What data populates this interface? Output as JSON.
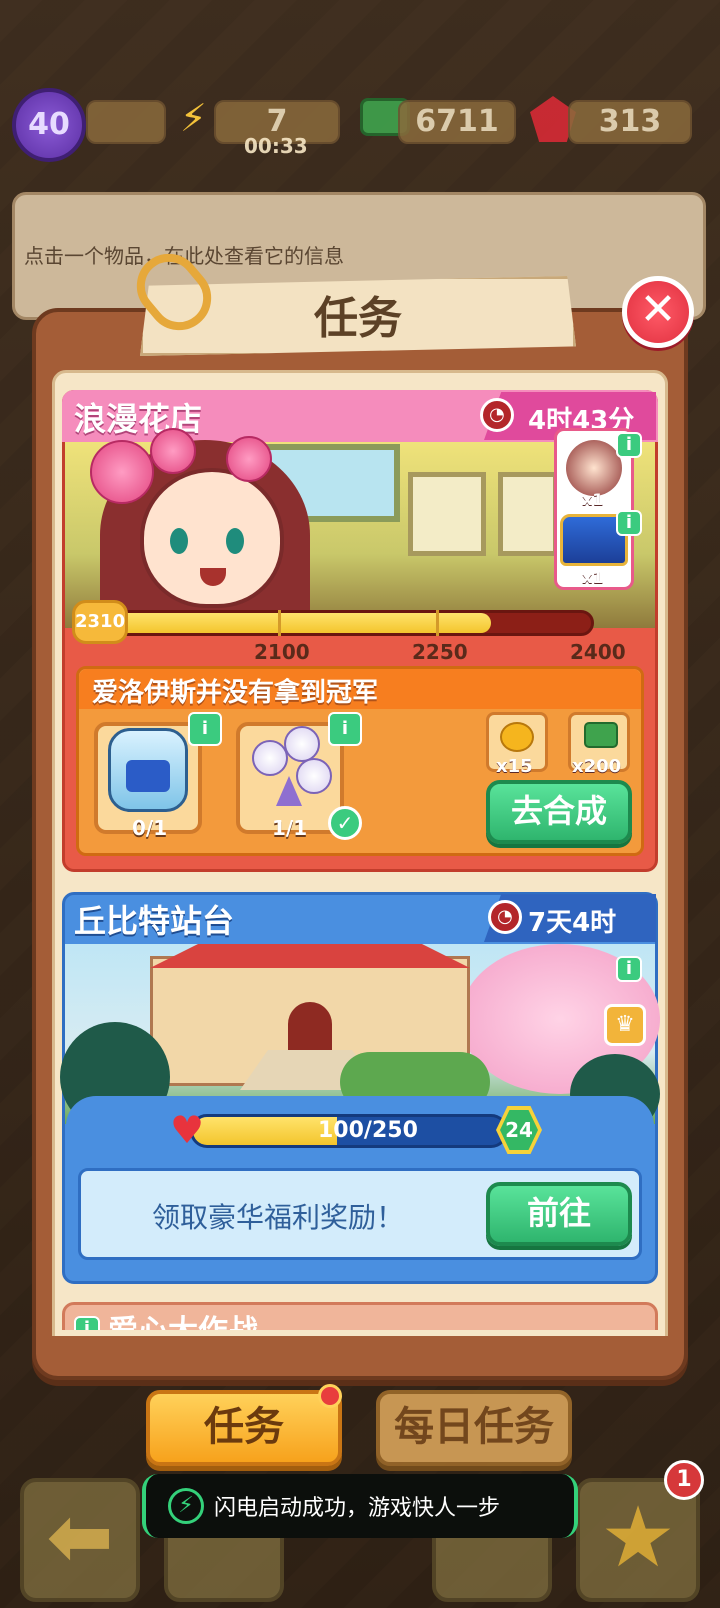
{
  "top_bar": {
    "level": "40",
    "energy": "7",
    "energy_timer": "00:33",
    "cash": "6711",
    "gems": "313"
  },
  "info_banner": {
    "text": "点击一个物品，在此处查看它的信息"
  },
  "dialog": {
    "title": "任务",
    "close_icon": "close-icon"
  },
  "card_flower_shop": {
    "title": "浪漫花店",
    "time_left": "4时43分",
    "rewards": [
      {
        "icon": "character-portrait",
        "count": "x1"
      },
      {
        "icon": "treasure-chest",
        "count": "x1"
      }
    ],
    "progress": {
      "current": "2310",
      "value": 2310,
      "ticks": [
        "2100",
        "2250",
        "2400"
      ],
      "min": 1950,
      "max": 2400
    },
    "quest": {
      "title": "爱洛伊斯并没有拿到冠军",
      "items": [
        {
          "icon": "sports-bottle",
          "count": "0/1",
          "done": false
        },
        {
          "icon": "balloon-bouquet",
          "count": "1/1",
          "done": true
        }
      ],
      "item_rewards": [
        {
          "icon": "gold-rose",
          "count": "x15"
        },
        {
          "icon": "cash-stack",
          "count": "x200"
        }
      ],
      "button": "去合成"
    }
  },
  "card_cupid": {
    "title": "丘比特站台",
    "time_left": "7天4时",
    "love_progress": {
      "text": "100/250",
      "value": 100,
      "max": 250
    },
    "level_badge": "24",
    "welfare_text": "领取豪华福利奖励！",
    "button": "前往"
  },
  "card_partial": {
    "title": "爱心大作战"
  },
  "tabs": {
    "tasks": "任务",
    "daily": "每日任务"
  },
  "nav": {
    "badge": "1"
  },
  "toast": {
    "text": "闪电启动成功，游戏快人一步"
  },
  "colors": {
    "pink_header": "#f58cbc",
    "card1_body": "#e85a47",
    "card2_body": "#4a8fe0",
    "green_button": "#2fb56e",
    "tab_active": "#f7a21c"
  }
}
